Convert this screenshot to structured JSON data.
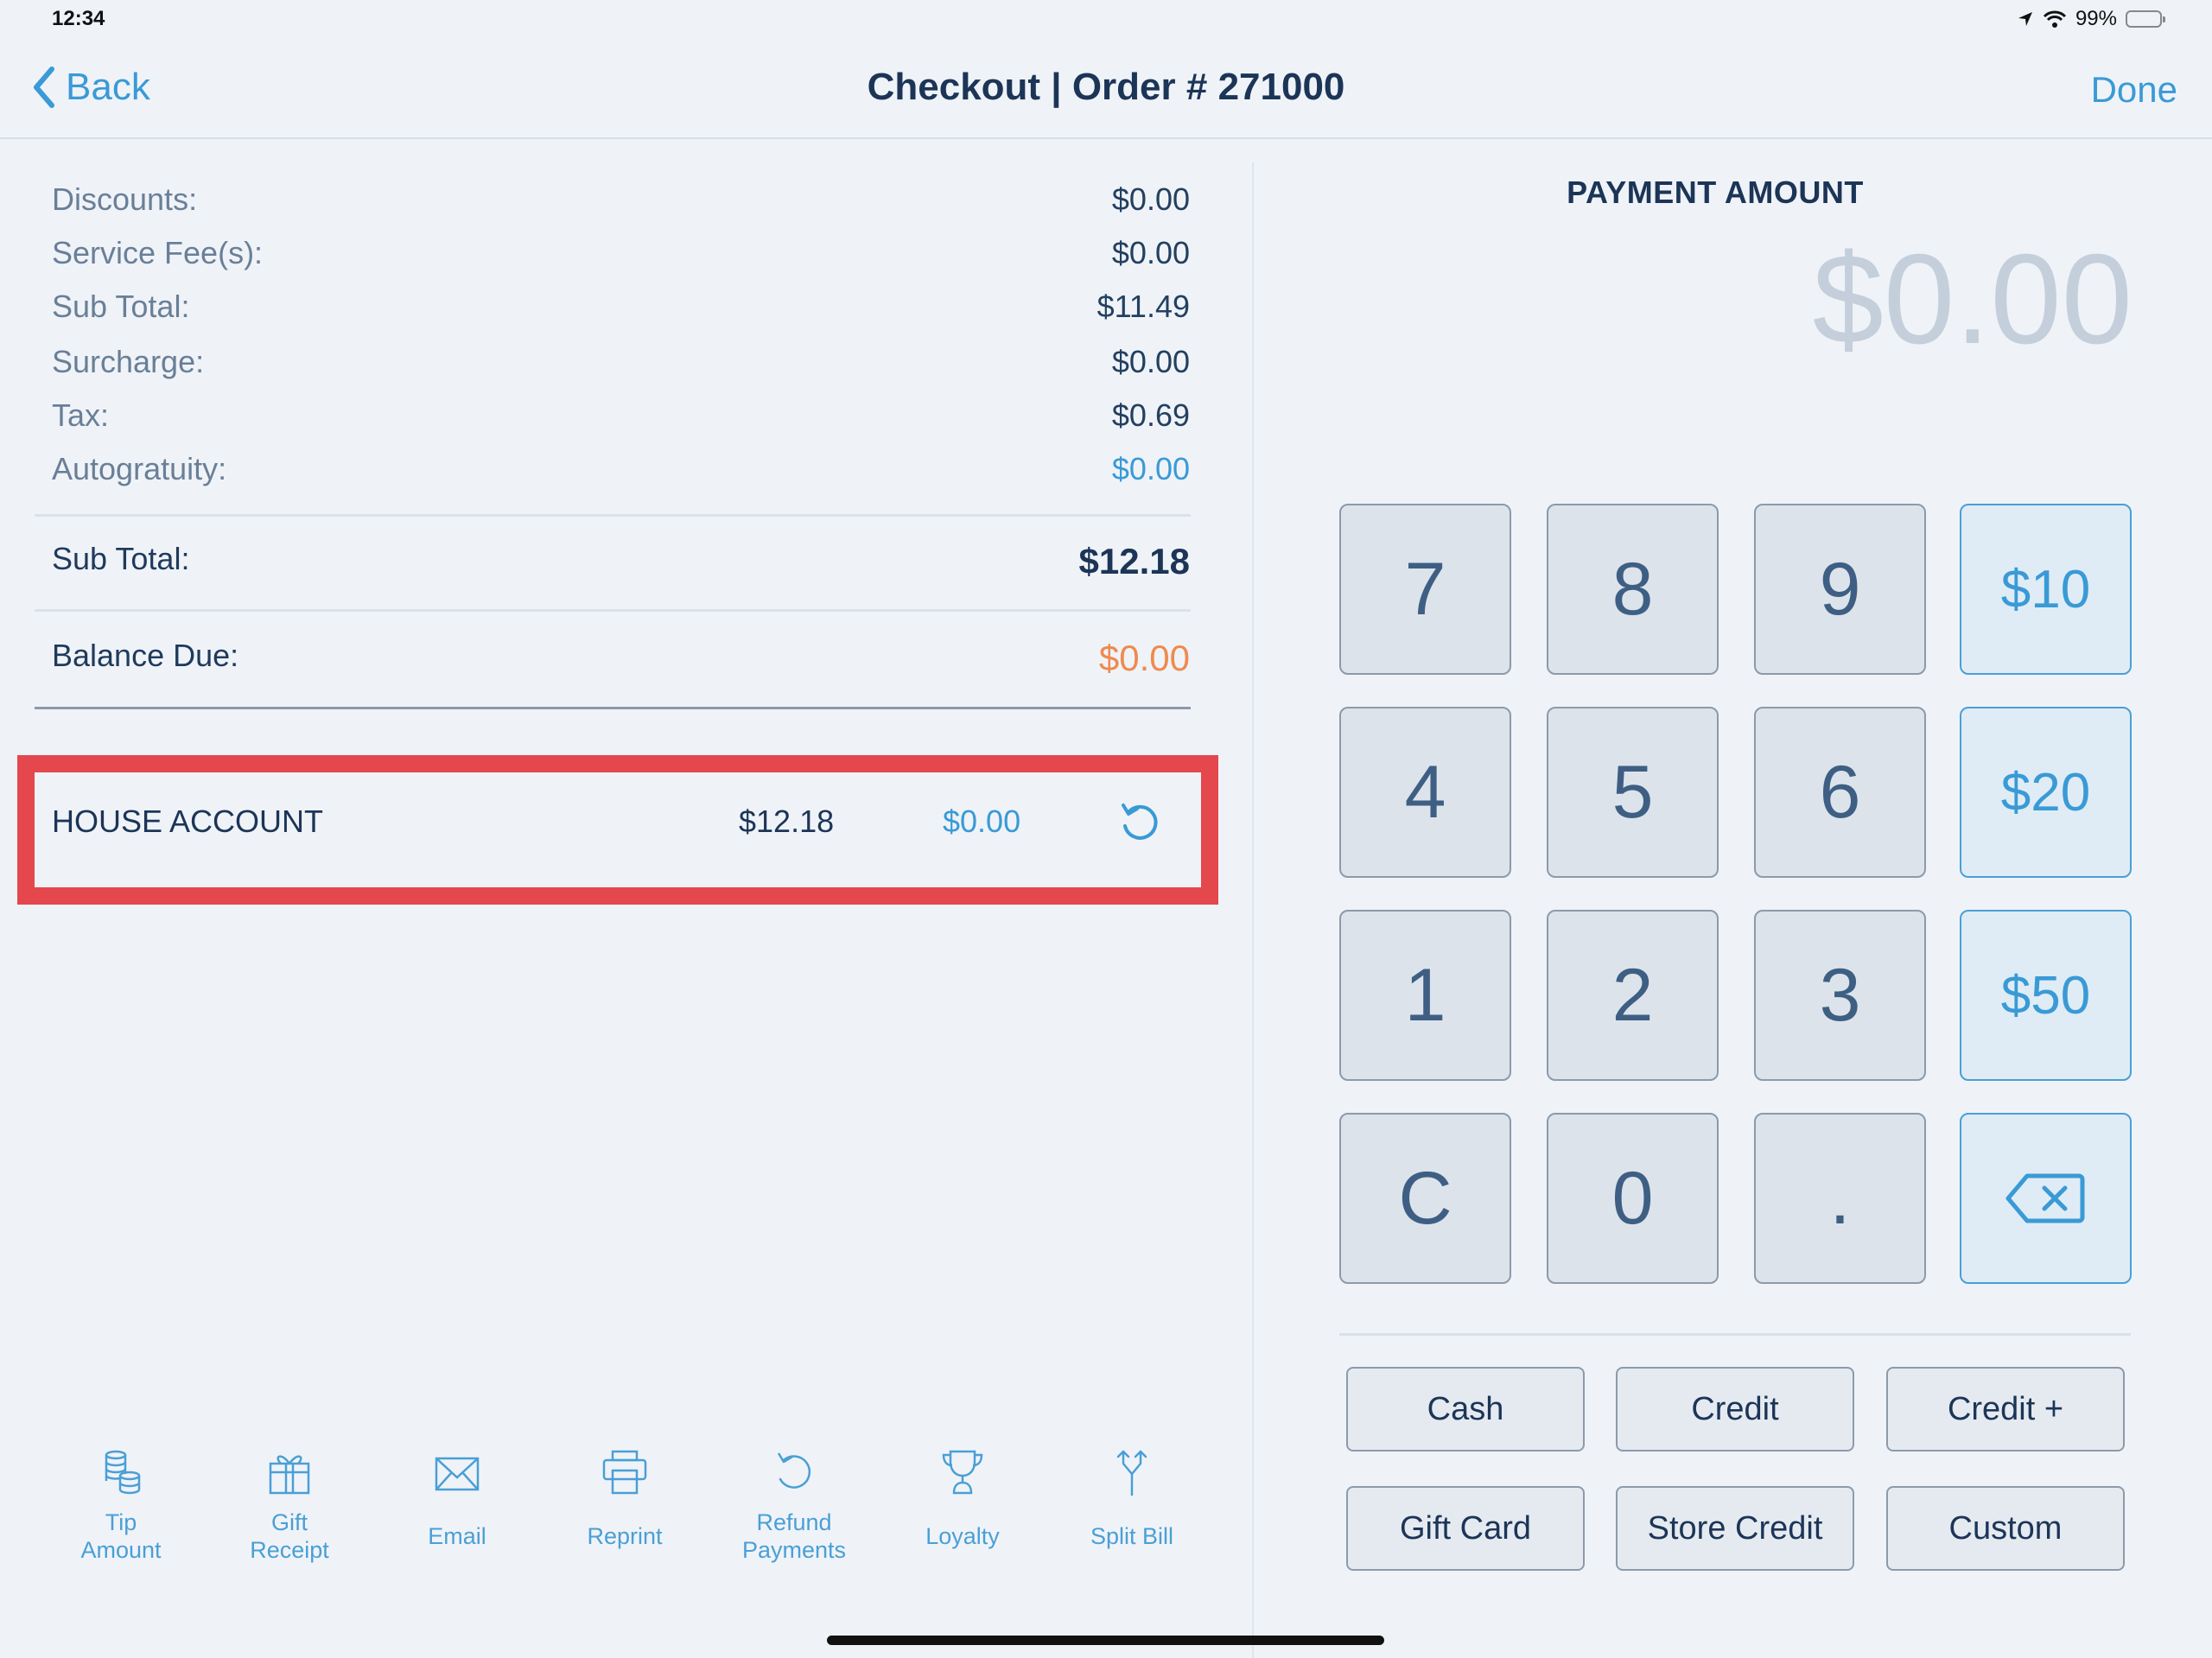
{
  "status_bar": {
    "time": "12:34",
    "battery": "99%",
    "icons": [
      "location-arrow-icon",
      "wifi-icon",
      "battery-icon"
    ]
  },
  "nav": {
    "back_label": "Back",
    "title": "Checkout | Order # 271000",
    "done_label": "Done"
  },
  "summary": {
    "rows": [
      {
        "label": "Discounts:",
        "value": "$0.00"
      },
      {
        "label": "Service Fee(s):",
        "value": "$0.00"
      },
      {
        "label": "Sub Total:",
        "value": "$11.49"
      },
      {
        "label": "Surcharge:",
        "value": "$0.00"
      },
      {
        "label": "Tax:",
        "value": "$0.69"
      },
      {
        "label": "Autogratuity:",
        "value": "$0.00"
      }
    ],
    "total": {
      "label": "Sub Total:",
      "value": "$12.18"
    },
    "balance": {
      "label": "Balance Due:",
      "value": "$0.00"
    }
  },
  "payments": [
    {
      "name": "HOUSE ACCOUNT",
      "amount": "$12.18",
      "balance": "$0.00",
      "action_icon": "undo-icon"
    }
  ],
  "highlight_color": "#e4474c",
  "actions": [
    {
      "label": "Tip Amount",
      "icon": "coins-icon"
    },
    {
      "label": "Gift Receipt",
      "icon": "gift-icon"
    },
    {
      "label": "Email",
      "icon": "envelope-icon"
    },
    {
      "label": "Reprint",
      "icon": "printer-icon"
    },
    {
      "label": "Refund Payments",
      "icon": "refund-icon"
    },
    {
      "label": "Loyalty",
      "icon": "trophy-icon"
    },
    {
      "label": "Split Bill",
      "icon": "split-icon"
    }
  ],
  "payment_amount": {
    "title": "PAYMENT AMOUNT",
    "value": "$0.00"
  },
  "keypad": {
    "keys": [
      "7",
      "8",
      "9",
      "$10",
      "4",
      "5",
      "6",
      "$20",
      "1",
      "2",
      "3",
      "$50",
      "C",
      "0",
      ".",
      "backspace"
    ]
  },
  "payment_methods": [
    "Cash",
    "Credit",
    "Credit +",
    "Gift Card",
    "Store Credit",
    "Custom"
  ],
  "colors": {
    "accent": "#3a9ad6",
    "balance": "#ef8a4f",
    "title": "#1c3557"
  }
}
